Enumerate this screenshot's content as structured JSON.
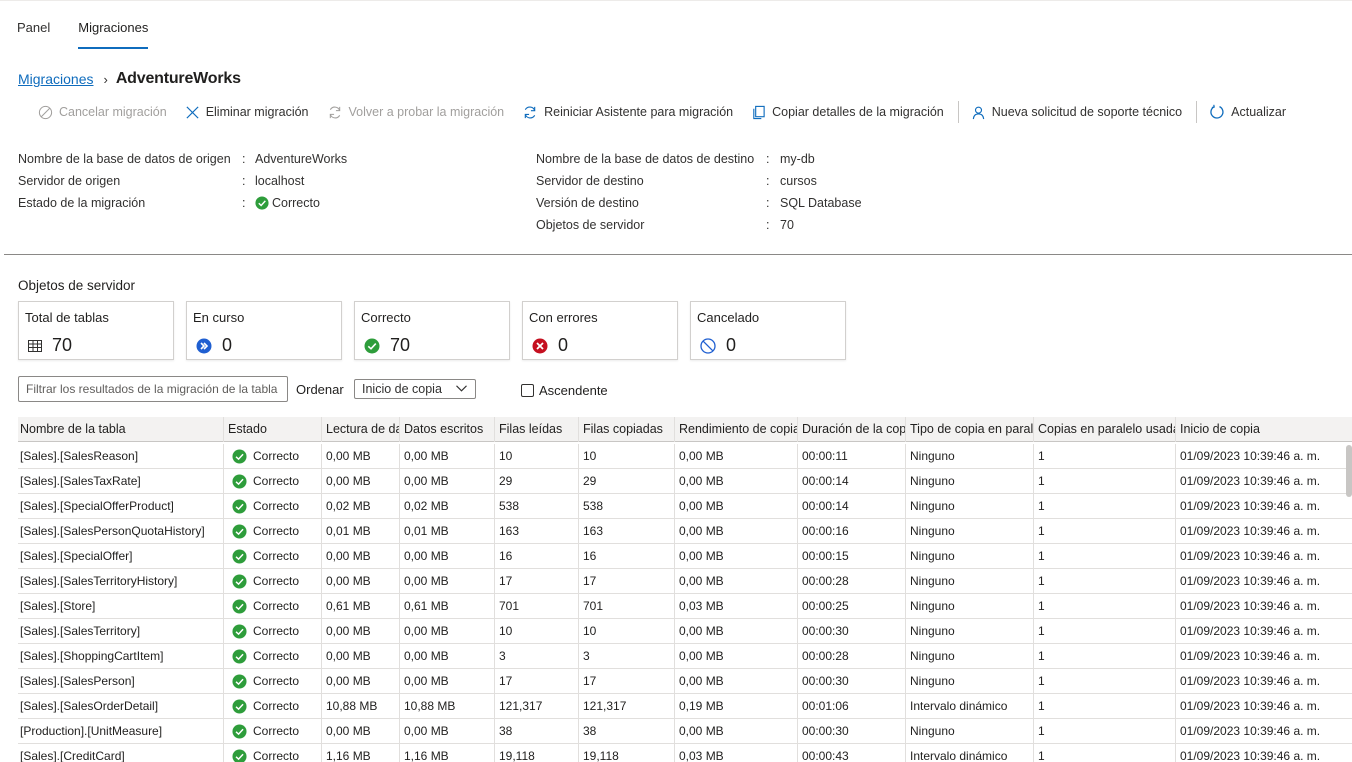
{
  "tabs": [
    "Panel",
    "Migraciones"
  ],
  "breadcrumb": {
    "link": "Migraciones",
    "current": "AdventureWorks"
  },
  "toolbar": {
    "cancel": "Cancelar migración",
    "delete": "Eliminar migración",
    "retry": "Volver a probar la migración",
    "restart": "Reiniciar Asistente para migración",
    "copy": "Copiar detalles de la migración",
    "support": "Nueva solicitud de soporte técnico",
    "refresh": "Actualizar"
  },
  "source": {
    "db_label": "Nombre de la base de datos de origen",
    "db_value": "AdventureWorks",
    "server_label": "Servidor de origen",
    "server_value": "localhost",
    "status_label": "Estado de la migración",
    "status_value": "Correcto"
  },
  "target": {
    "db_label": "Nombre de la base de datos de destino",
    "db_value": "my-db",
    "server_label": "Servidor de destino",
    "server_value": "cursos",
    "version_label": "Versión de destino",
    "version_value": "SQL Database",
    "objects_label": "Objetos de servidor",
    "objects_value": "70"
  },
  "colon": ":",
  "section_title": "Objetos de servidor",
  "cards": {
    "total": {
      "title": "Total de tablas",
      "value": "70"
    },
    "in_progress": {
      "title": "En curso",
      "value": "0"
    },
    "success": {
      "title": "Correcto",
      "value": "70"
    },
    "errors": {
      "title": "Con errores",
      "value": "0"
    },
    "cancelled": {
      "title": "Cancelado",
      "value": "0"
    }
  },
  "filter": {
    "placeholder": "Filtrar los resultados de la migración de la tabla"
  },
  "sort": {
    "label": "Ordenar",
    "value": "Inicio de copia",
    "ascending_label": "Ascendente"
  },
  "table": {
    "headers": [
      "Nombre de la tabla",
      "Estado",
      "Lectura de datos",
      "Datos escritos",
      "Filas leídas",
      "Filas copiadas",
      "Rendimiento de copia",
      "Duración de la copia",
      "Tipo de copia en paralelo",
      "Copias en paralelo usadas",
      "Inicio de copia"
    ],
    "rows": [
      [
        "[Sales].[SalesReason]",
        "Correcto",
        "0,00 MB",
        "0,00 MB",
        "10",
        "10",
        "0,00 MB",
        "00:00:11",
        "Ninguno",
        "1",
        "01/09/2023 10:39:46 a. m."
      ],
      [
        "[Sales].[SalesTaxRate]",
        "Correcto",
        "0,00 MB",
        "0,00 MB",
        "29",
        "29",
        "0,00 MB",
        "00:00:14",
        "Ninguno",
        "1",
        "01/09/2023 10:39:46 a. m."
      ],
      [
        "[Sales].[SpecialOfferProduct]",
        "Correcto",
        "0,02 MB",
        "0,02 MB",
        "538",
        "538",
        "0,00 MB",
        "00:00:14",
        "Ninguno",
        "1",
        "01/09/2023 10:39:46 a. m."
      ],
      [
        "[Sales].[SalesPersonQuotaHistory]",
        "Correcto",
        "0,01 MB",
        "0,01 MB",
        "163",
        "163",
        "0,00 MB",
        "00:00:16",
        "Ninguno",
        "1",
        "01/09/2023 10:39:46 a. m."
      ],
      [
        "[Sales].[SpecialOffer]",
        "Correcto",
        "0,00 MB",
        "0,00 MB",
        "16",
        "16",
        "0,00 MB",
        "00:00:15",
        "Ninguno",
        "1",
        "01/09/2023 10:39:46 a. m."
      ],
      [
        "[Sales].[SalesTerritoryHistory]",
        "Correcto",
        "0,00 MB",
        "0,00 MB",
        "17",
        "17",
        "0,00 MB",
        "00:00:28",
        "Ninguno",
        "1",
        "01/09/2023 10:39:46 a. m."
      ],
      [
        "[Sales].[Store]",
        "Correcto",
        "0,61 MB",
        "0,61 MB",
        "701",
        "701",
        "0,03 MB",
        "00:00:25",
        "Ninguno",
        "1",
        "01/09/2023 10:39:46 a. m."
      ],
      [
        "[Sales].[SalesTerritory]",
        "Correcto",
        "0,00 MB",
        "0,00 MB",
        "10",
        "10",
        "0,00 MB",
        "00:00:30",
        "Ninguno",
        "1",
        "01/09/2023 10:39:46 a. m."
      ],
      [
        "[Sales].[ShoppingCartItem]",
        "Correcto",
        "0,00 MB",
        "0,00 MB",
        "3",
        "3",
        "0,00 MB",
        "00:00:28",
        "Ninguno",
        "1",
        "01/09/2023 10:39:46 a. m."
      ],
      [
        "[Sales].[SalesPerson]",
        "Correcto",
        "0,00 MB",
        "0,00 MB",
        "17",
        "17",
        "0,00 MB",
        "00:00:30",
        "Ninguno",
        "1",
        "01/09/2023 10:39:46 a. m."
      ],
      [
        "[Sales].[SalesOrderDetail]",
        "Correcto",
        "10,88 MB",
        "10,88 MB",
        "121,317",
        "121,317",
        "0,19 MB",
        "00:01:06",
        "Intervalo dinámico",
        "1",
        "01/09/2023 10:39:46 a. m."
      ],
      [
        "[Production].[UnitMeasure]",
        "Correcto",
        "0,00 MB",
        "0,00 MB",
        "38",
        "38",
        "0,00 MB",
        "00:00:30",
        "Ninguno",
        "1",
        "01/09/2023 10:39:46 a. m."
      ],
      [
        "[Sales].[CreditCard]",
        "Correcto",
        "1,16 MB",
        "1,16 MB",
        "19,118",
        "19,118",
        "0,03 MB",
        "00:00:43",
        "Intervalo dinámico",
        "1",
        "01/09/2023 10:39:46 a. m."
      ]
    ]
  },
  "colors": {
    "accent": "#0f6cbd",
    "success": "#2e9d3b",
    "error": "#c50f1f",
    "progress": "#1f5fd1"
  }
}
